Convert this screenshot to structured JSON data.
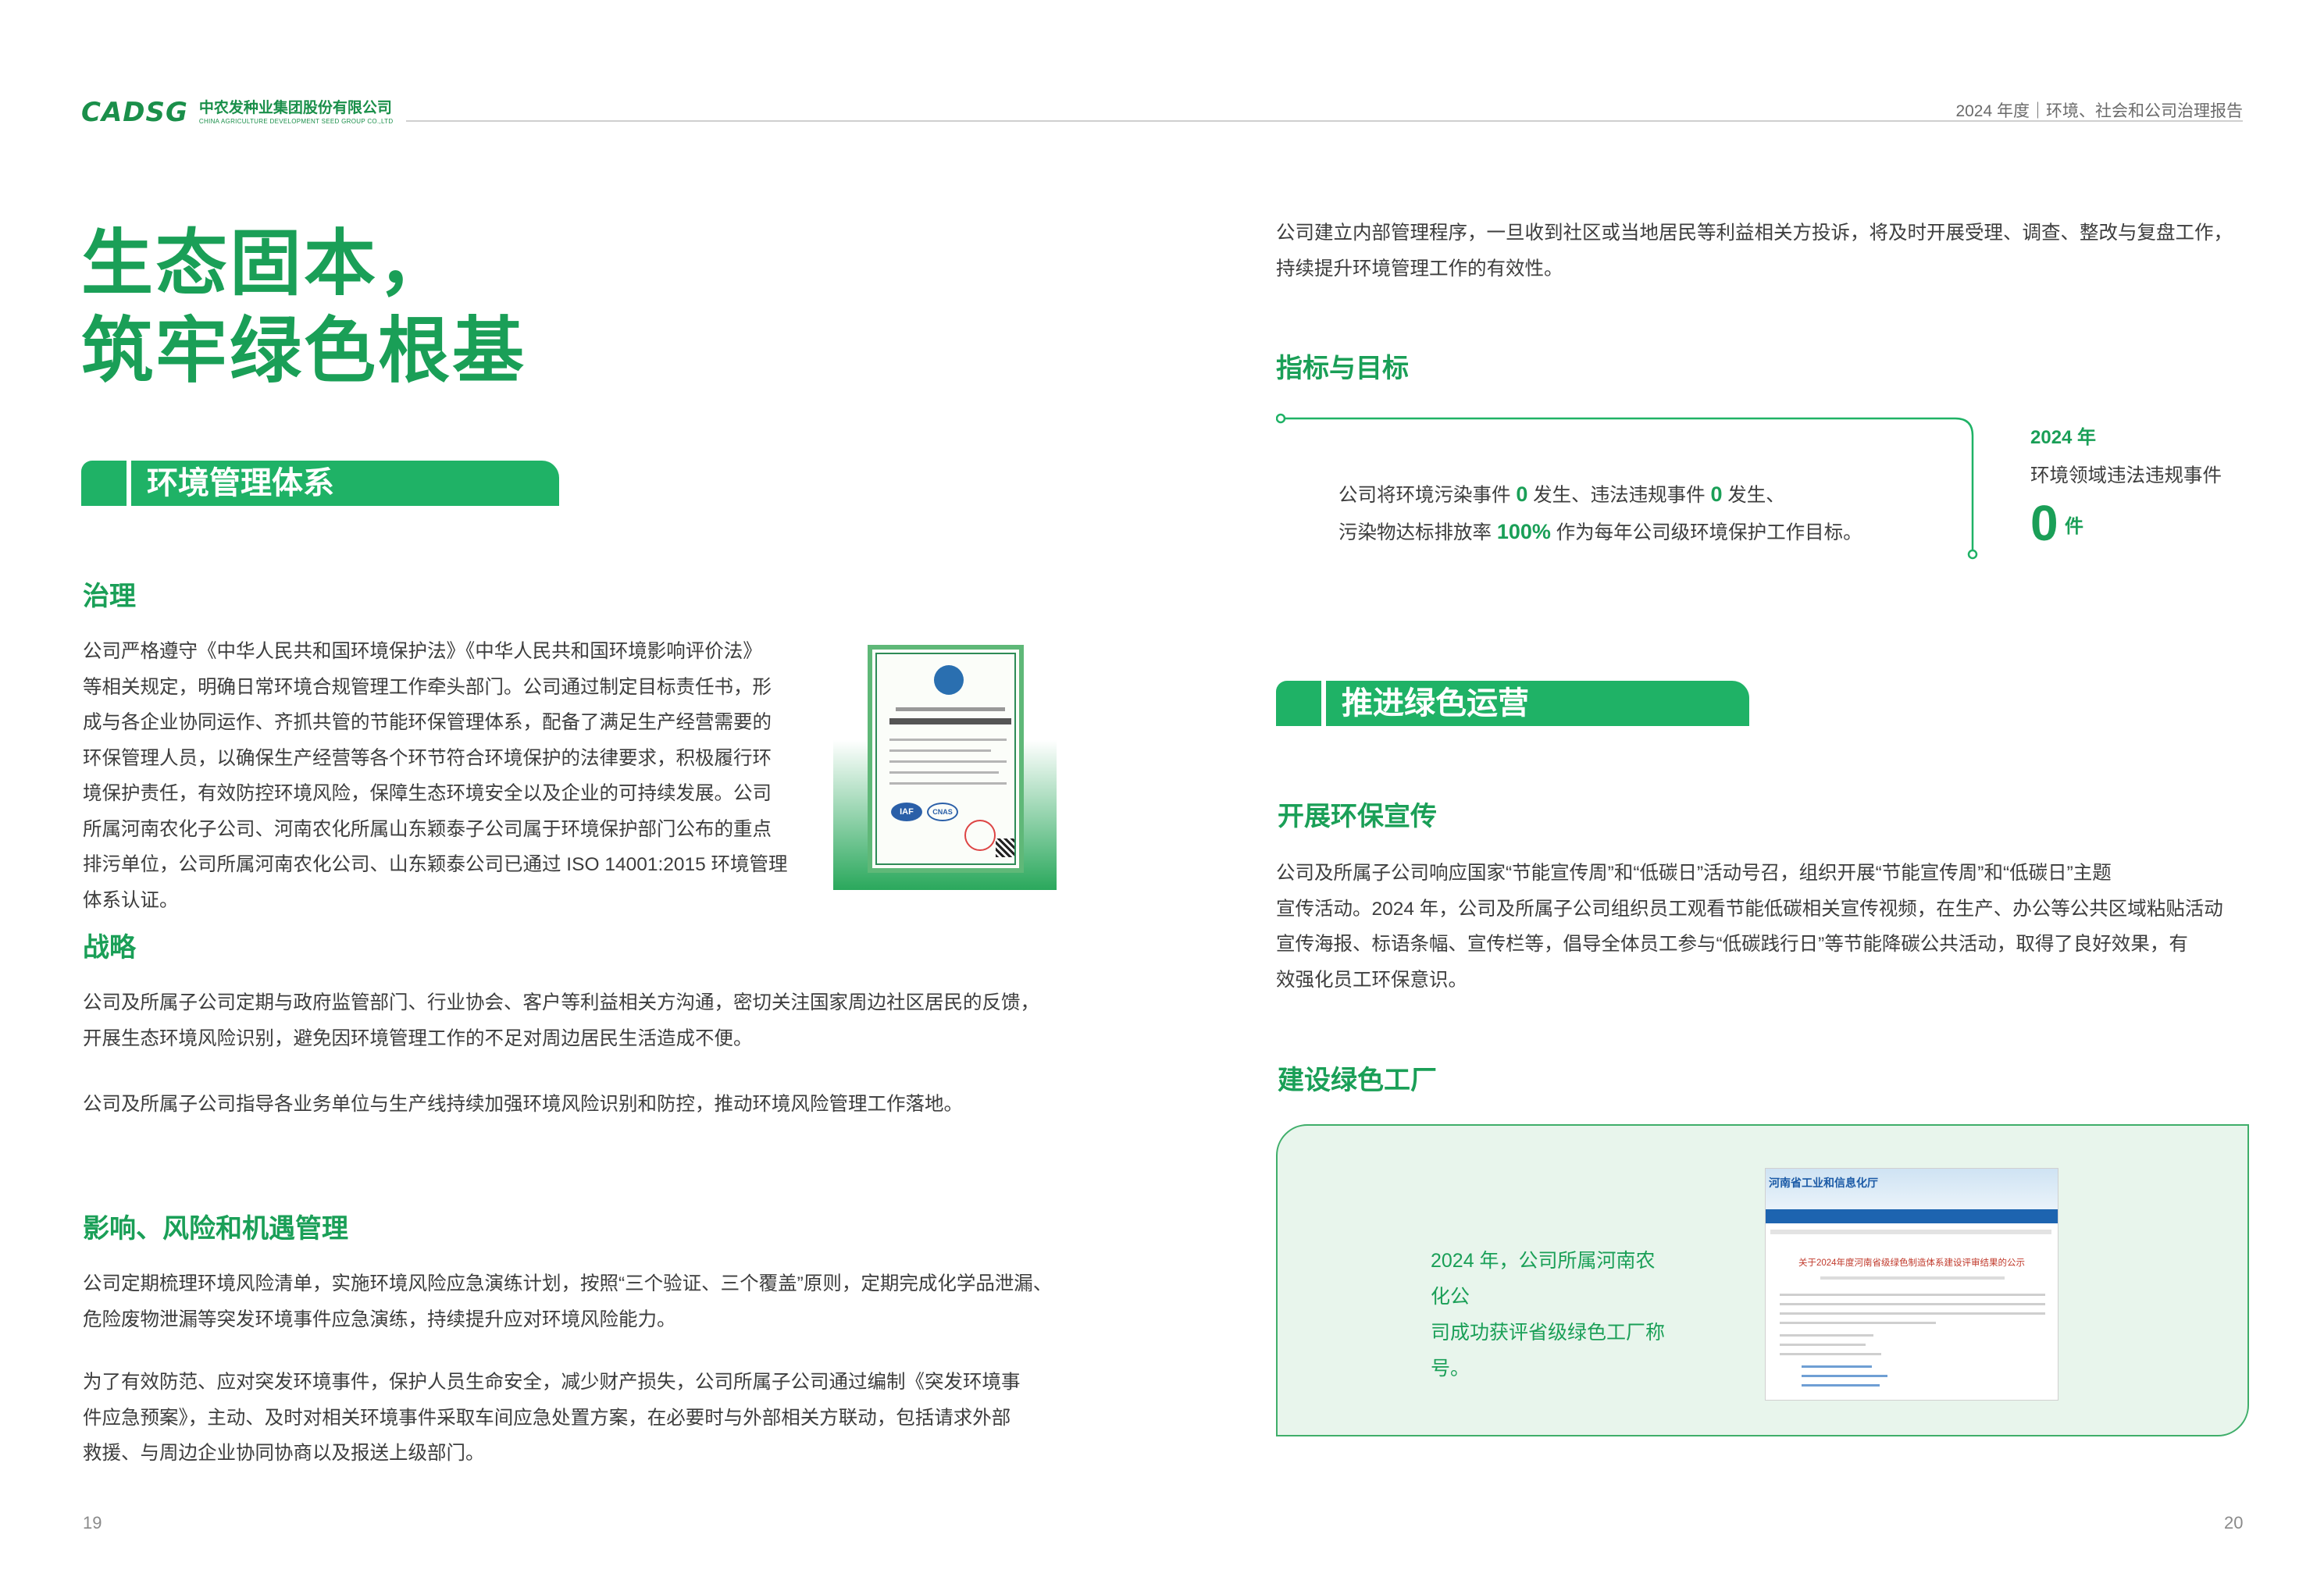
{
  "header": {
    "logo_mark": "CADSG",
    "company_cn": "中农发种业集团股份有限公司",
    "company_en": "CHINA AGRICULTURE DEVELOPMENT SEED GROUP CO.,LTD",
    "report_title": "2024 年度｜环境、社会和公司治理报告"
  },
  "left": {
    "hero_line1": "生态固本，",
    "hero_line2": "筑牢绿色根基",
    "section_title": "环境管理体系",
    "governance": {
      "heading": "治理",
      "lines": [
        "公司严格遵守《中华人民共和国环境保护法》《中华人民共和国环境影响评价法》",
        "等相关规定，明确日常环境合规管理工作牵头部门。公司通过制定目标责任书，形",
        "成与各企业协同运作、齐抓共管的节能环保管理体系，配备了满足生产经营需要的",
        "环保管理人员，以确保生产经营等各个环节符合环境保护的法律要求，积极履行环",
        "境保护责任，有效防控环境风险，保障生态环境安全以及企业的可持续发展。公司",
        "所属河南农化子公司、河南农化所属山东颖泰子公司属于环境保护部门公布的重点",
        "排污单位，公司所属河南农化公司、山东颖泰公司已通过 ISO 14001:2015 环境管理",
        "体系认证。"
      ],
      "cert_iaf": "IAF",
      "cert_cnas": "CNAS"
    },
    "strategy": {
      "heading": "战略",
      "p1_lines": [
        "公司及所属子公司定期与政府监管部门、行业协会、客户等利益相关方沟通，密切关注国家周边社区居民的反馈，",
        "开展生态环境风险识别，避免因环境管理工作的不足对周边居民生活造成不便。"
      ],
      "p2": "公司及所属子公司指导各业务单位与生产线持续加强环境风险识别和防控，推动环境风险管理工作落地。"
    },
    "risk": {
      "heading": "影响、风险和机遇管理",
      "p1_lines": [
        "公司定期梳理环境风险清单，实施环境风险应急演练计划，按照“三个验证、三个覆盖”原则，定期完成化学品泄漏、",
        "危险废物泄漏等突发环境事件应急演练，持续提升应对环境风险能力。"
      ],
      "p2_lines": [
        "为了有效防范、应对突发环境事件，保护人员生命安全，减少财产损失，公司所属子公司通过编制《突发环境事",
        "件应急预案》，主动、及时对相关环境事件采取车间应急处置方案，在必要时与外部相关方联动，包括请求外部",
        "救援、与周边企业协同协商以及报送上级部门。"
      ]
    },
    "page_number": "19"
  },
  "right": {
    "complaint_lines": [
      "公司建立内部管理程序，一旦收到社区或当地居民等利益相关方投诉，将及时开展受理、调查、整改与复盘工作，",
      "持续提升环境管理工作的有效性。"
    ],
    "targets": {
      "heading": "指标与目标",
      "line1_a": "公司将环境污染事件 ",
      "line1_v1": "0",
      "line1_b": " 发生、违法违规事件 ",
      "line1_v2": "0",
      "line1_c": " 发生、",
      "line2_a": "污染物达标排放率 ",
      "line2_v": "100%",
      "line2_b": " 作为每年公司级环境保护工作目标。",
      "kpi_year": "2024 年",
      "kpi_label": "环境领域违法违规事件",
      "kpi_value": "0",
      "kpi_unit": "件"
    },
    "section_title": "推进绿色运营",
    "promotion": {
      "heading": "开展环保宣传",
      "lines": [
        "公司及所属子公司响应国家“节能宣传周”和“低碳日”活动号召，组织开展“节能宣传周”和“低碳日”主题",
        "宣传活动。2024 年，公司及所属子公司组织员工观看节能低碳相关宣传视频，在生产、办公等公共区域粘贴活动",
        "宣传海报、标语条幅、宣传栏等，倡导全体员工参与“低碳践行日”等节能降碳公共活动，取得了良好效果，有",
        "效强化员工环保意识。"
      ]
    },
    "factory": {
      "heading": "建设绿色工厂",
      "box_line1": "2024 年，公司所属河南农化公",
      "box_line2": "司成功获评省级绿色工厂称号。",
      "shot_site": "河南省工业和信息化厅",
      "shot_headline": "关于2024年度河南省级绿色制造体系建设评审结果的公示"
    },
    "page_number": "20"
  }
}
